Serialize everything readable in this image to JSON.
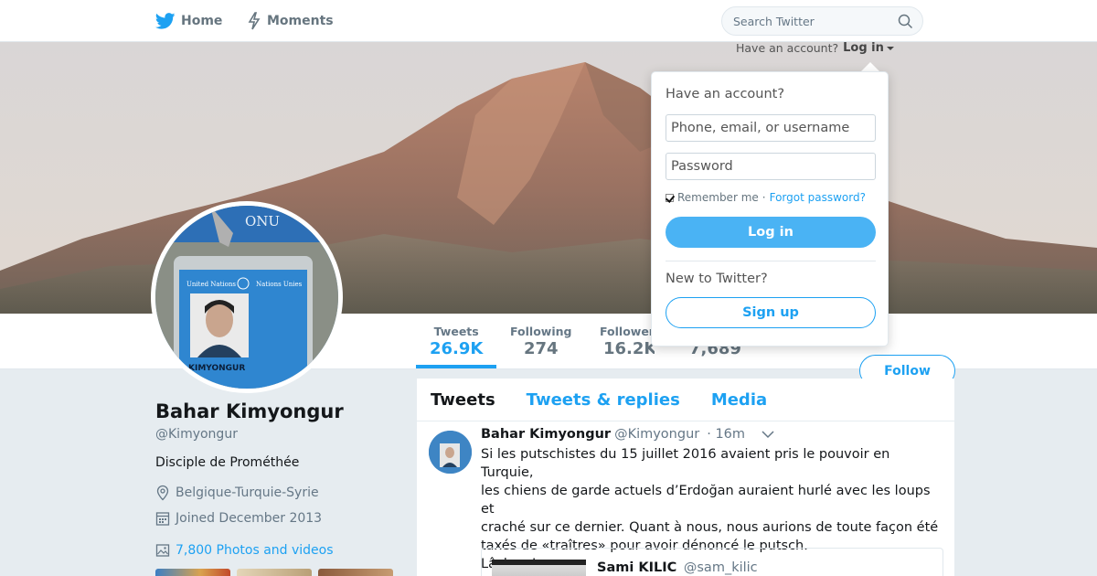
{
  "nav": {
    "home_label": "Home",
    "moments_label": "Moments",
    "search_placeholder": "Search Twitter",
    "have_account": "Have an account?",
    "login_label": "Log in"
  },
  "profile": {
    "name": "Bahar Kimyongur",
    "handle": "@Kimyongur",
    "bio": "Disciple de Prométhée",
    "location": "Belgique-Turquie-Syrie",
    "joined": "Joined December 2013",
    "photos_link": "7,800 Photos and videos",
    "avatar_badge_text": "KIMYONGUR",
    "lanyard_text": "ONU",
    "badge_org_left": "United Nations",
    "badge_org_right": "Nations Unies"
  },
  "stats": [
    {
      "label": "Tweets",
      "value": "26.9K"
    },
    {
      "label": "Following",
      "value": "274"
    },
    {
      "label": "Followers",
      "value": "16.2K"
    },
    {
      "label": "",
      "value": "7,689"
    }
  ],
  "follow_label": "Follow",
  "timeline": {
    "tabs": [
      "Tweets",
      "Tweets & replies",
      "Media"
    ],
    "tweet": {
      "name": "Bahar Kimyongur",
      "handle": "@Kimyongur",
      "time": "· 16m",
      "lines": [
        "Si les putschistes du 15 juillet 2016 avaient pris le pouvoir en Turquie,",
        "les chiens de garde actuels d’Erdoğan auraient hurlé avec les loups et",
        "craché sur ce dernier. Quant à nous, nous aurions de toute façon été",
        "taxés de «traîtres» pour avoir dénoncé le putsch.",
        "Lâches !"
      ],
      "quote": {
        "name": "Sami KILIC",
        "handle": "@sam_kilic"
      }
    }
  },
  "login_dropdown": {
    "heading": "Have an account?",
    "username_placeholder": "Phone, email, or username",
    "password_placeholder": "Password",
    "remember": "Remember me",
    "separator": "·",
    "forgot": "Forgot password?",
    "login_button": "Log in",
    "new_heading": "New to Twitter?",
    "signup_button": "Sign up"
  },
  "colors": {
    "accent": "#1da1f2",
    "login_button": "#4ab3f4",
    "page_bg": "#e6ecf0"
  }
}
